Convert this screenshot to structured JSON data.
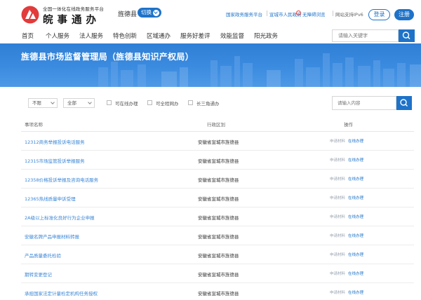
{
  "header": {
    "platform_line": "全国一体化在线政务服务平台",
    "brand": "皖事通办",
    "region": "旌德县",
    "switch_label": "切换",
    "links": {
      "national_portal": "国家政务服务平台",
      "city_gov": "宣城市人民政府",
      "accessibility": "无障碍浏览",
      "ipv6": "网站支持IPv6"
    },
    "login_label": "登录",
    "register_label": "注册"
  },
  "nav": {
    "items": [
      "首页",
      "个人服务",
      "法人服务",
      "特色创新",
      "区域通办",
      "服务好差评",
      "效能监督",
      "阳光政务"
    ],
    "search_placeholder": "请输入关键字"
  },
  "banner": {
    "title": "旌德县市场监督管理局（旌德县知识产权局）"
  },
  "filters": {
    "select_1": "不限",
    "select_2": "全部",
    "checks": [
      "可在线办理",
      "可全程网办",
      "长三角通办"
    ],
    "search_placeholder": "请输入内容"
  },
  "table": {
    "headers": [
      "事项名称",
      "行政区划",
      "操作"
    ],
    "op_labels": [
      "申请材料",
      "在线办理"
    ],
    "rows": [
      {
        "name": "12312商务举报投诉电话服务",
        "area": "安徽省宣城市旌德县"
      },
      {
        "name": "12315市场监管投诉举报服务",
        "area": "安徽省宣城市旌德县"
      },
      {
        "name": "12358价格投诉举报及咨询电话服务",
        "area": "安徽省宣城市旌德县"
      },
      {
        "name": "12365热线质量申诉受理",
        "area": "安徽省宣城市旌德县"
      },
      {
        "name": "2A级以上标准化良好行为企业申报",
        "area": "安徽省宣城市旌德县"
      },
      {
        "name": "安徽名牌产品申报材料转报",
        "area": "安徽省宣城市旌德县"
      },
      {
        "name": "产品质量委托检验",
        "area": "安徽省宣城市旌德县"
      },
      {
        "name": "期转变更登记",
        "area": "安徽省宣城市旌德县"
      },
      {
        "name": "承担国家法定计量检定机构任务授权",
        "area": "安徽省宣城市旌德县"
      }
    ]
  },
  "colors": {
    "primary": "#1e73c9",
    "banner": "#3b8be0",
    "link": "#3a86d6",
    "logo": "#e23b3b"
  }
}
